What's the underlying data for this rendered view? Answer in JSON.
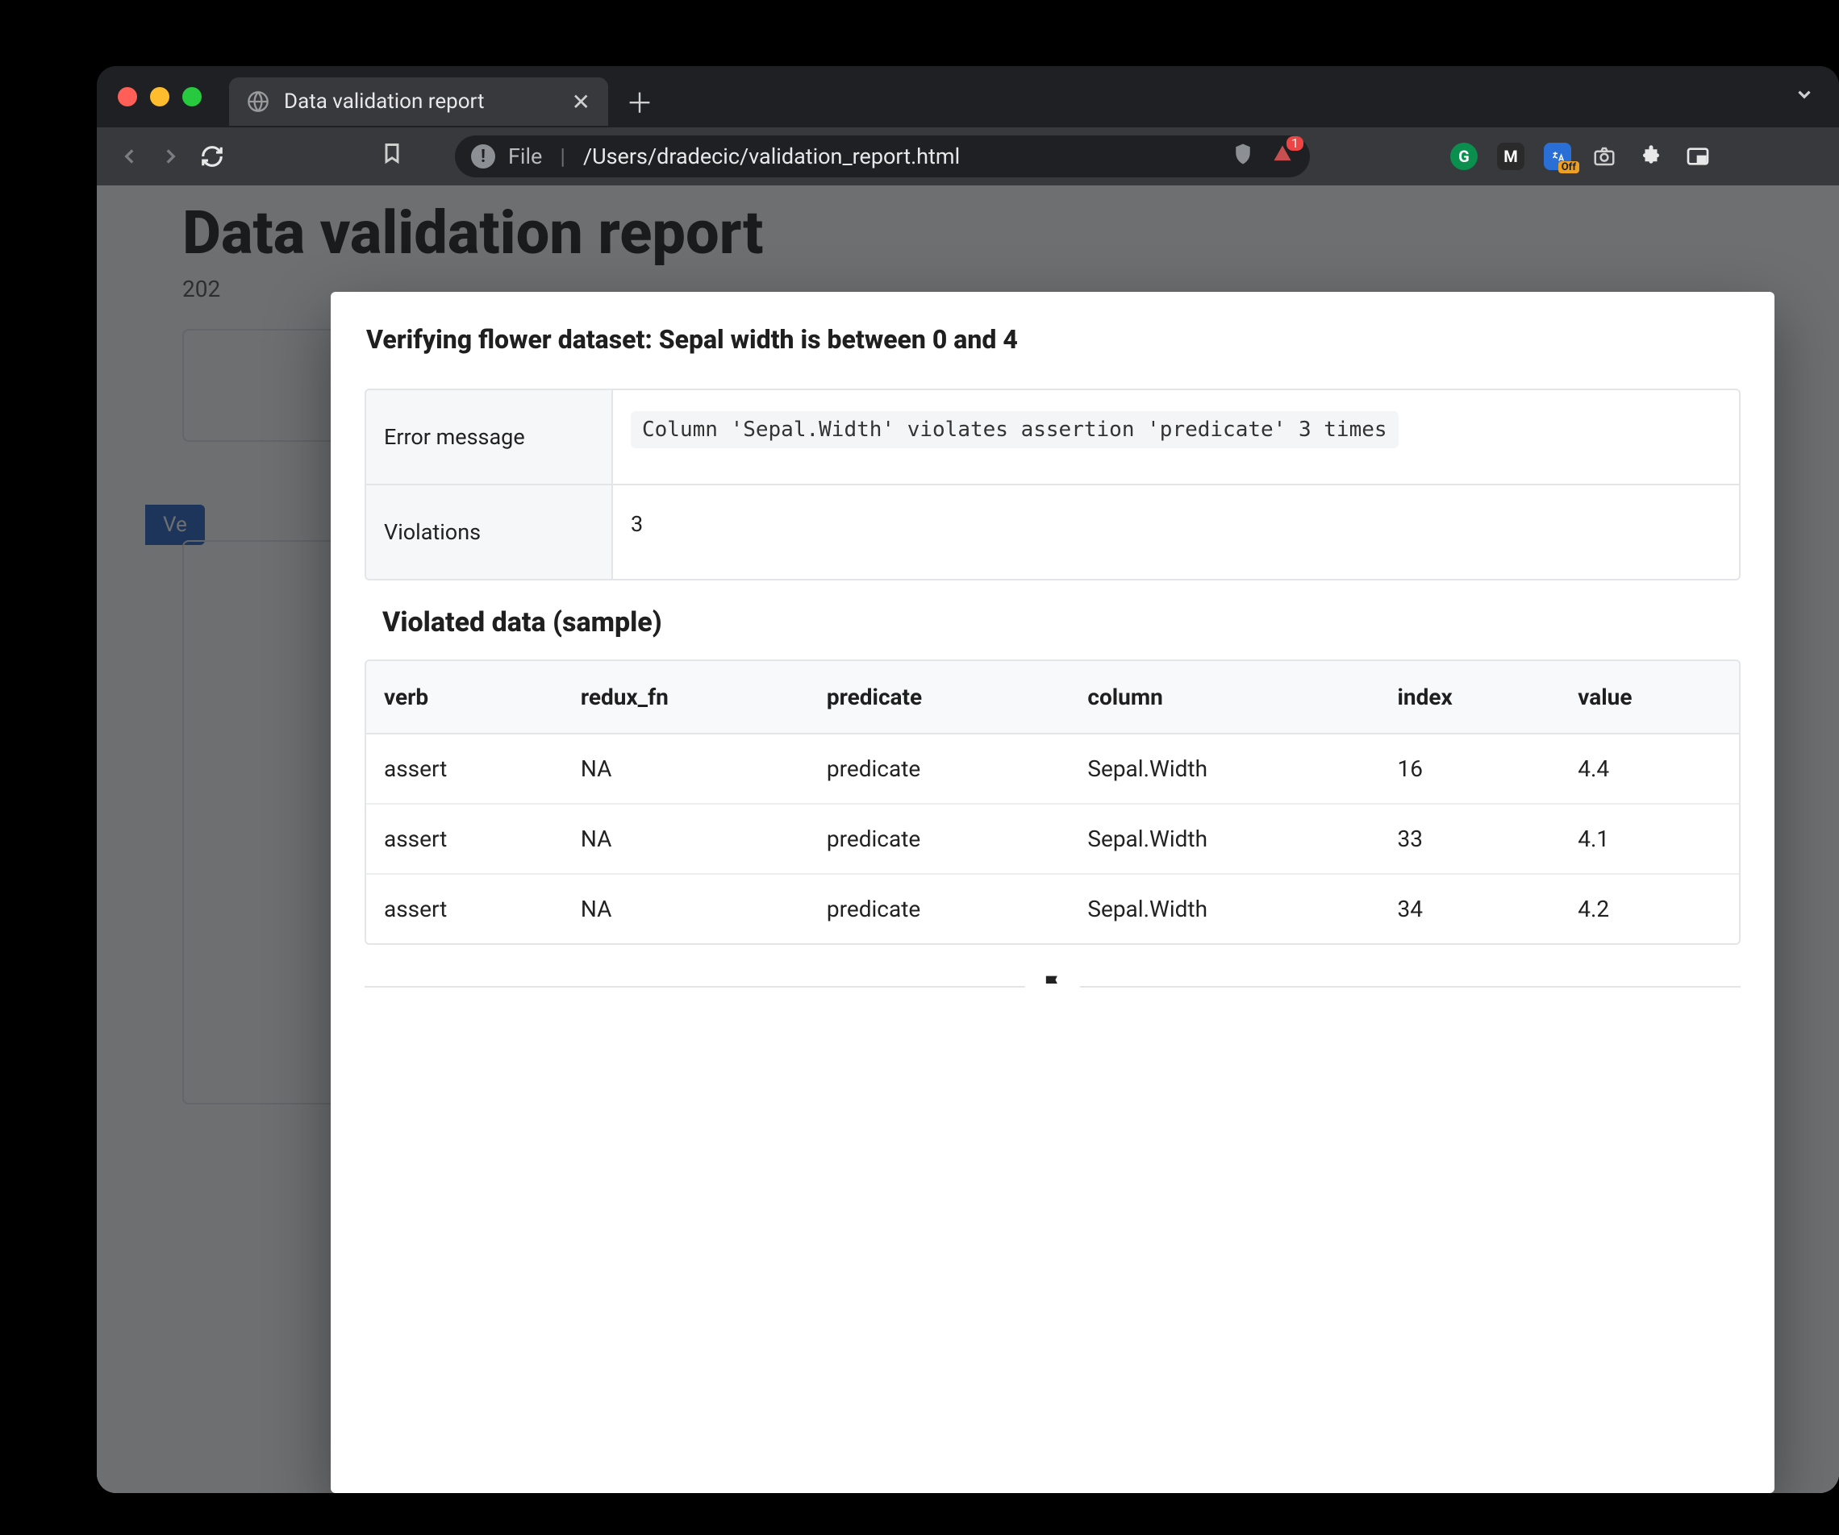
{
  "browser": {
    "tab_title": "Data validation report",
    "url_scheme": "File",
    "url_path": "/Users/dradecic/validation_report.html",
    "brave_badge_count": "1",
    "translate_off_label": "Off"
  },
  "page": {
    "title": "Data validation report",
    "timestamp_prefix": "202",
    "badge_prefix": "Ve"
  },
  "modal": {
    "title": "Verifying flower dataset: Sepal width is between 0 and 4",
    "kv": {
      "error_label": "Error message",
      "error_value": "Column 'Sepal.Width' violates assertion 'predicate' 3 times",
      "violations_label": "Violations",
      "violations_value": "3"
    },
    "section_title": "Violated data (sample)",
    "columns": [
      "verb",
      "redux_fn",
      "predicate",
      "column",
      "index",
      "value"
    ],
    "rows": [
      {
        "verb": "assert",
        "redux_fn": "NA",
        "predicate": "predicate",
        "column": "Sepal.Width",
        "index": "16",
        "value": "4.4"
      },
      {
        "verb": "assert",
        "redux_fn": "NA",
        "predicate": "predicate",
        "column": "Sepal.Width",
        "index": "33",
        "value": "4.1"
      },
      {
        "verb": "assert",
        "redux_fn": "NA",
        "predicate": "predicate",
        "column": "Sepal.Width",
        "index": "34",
        "value": "4.2"
      }
    ]
  }
}
